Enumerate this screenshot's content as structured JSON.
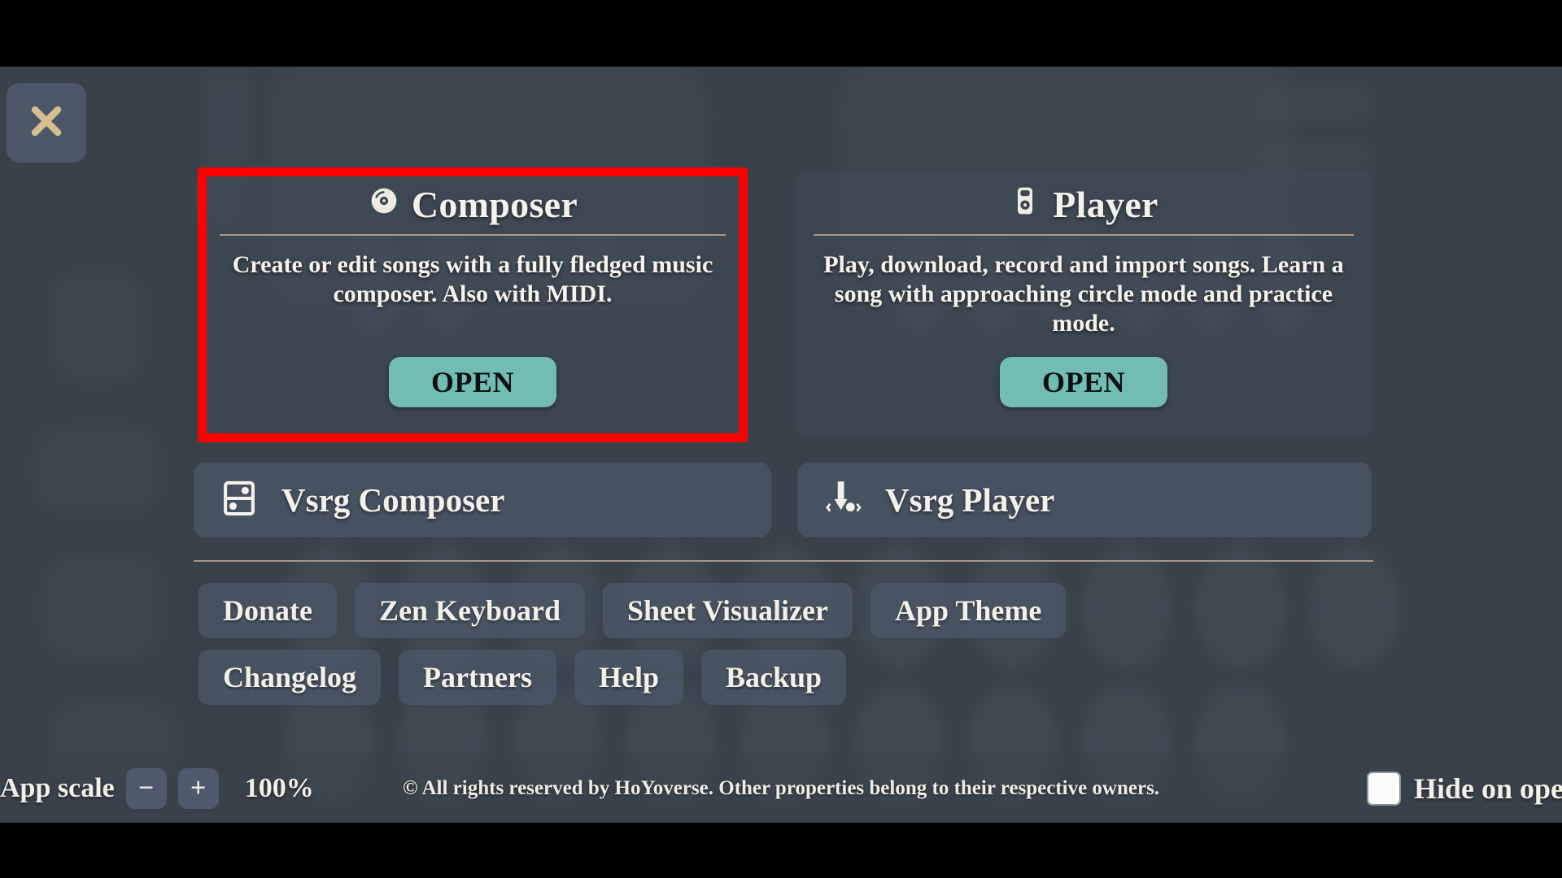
{
  "window": {
    "close_icon": "close-x-icon"
  },
  "cards": [
    {
      "id": "composer",
      "icon": "disc-icon",
      "title": "Composer",
      "description": "Create or edit songs with a fully fledged music composer. Also with MIDI.",
      "open_label": "OPEN",
      "highlighted": true
    },
    {
      "id": "player",
      "icon": "music-player-icon",
      "title": "Player",
      "description": "Play, download, record and import songs. Learn a song with approaching circle mode and practice mode.",
      "open_label": "OPEN",
      "highlighted": false
    }
  ],
  "vsrg": [
    {
      "id": "vsrg-composer",
      "icon": "vsrg-composer-icon",
      "label": "Vsrg Composer"
    },
    {
      "id": "vsrg-player",
      "icon": "vsrg-player-icon",
      "label": "Vsrg Player"
    }
  ],
  "pill_rows": [
    [
      {
        "id": "donate",
        "label": "Donate"
      },
      {
        "id": "zen-keyboard",
        "label": "Zen Keyboard"
      },
      {
        "id": "sheet-visualizer",
        "label": "Sheet Visualizer"
      },
      {
        "id": "app-theme",
        "label": "App Theme"
      }
    ],
    [
      {
        "id": "changelog",
        "label": "Changelog"
      },
      {
        "id": "partners",
        "label": "Partners"
      },
      {
        "id": "help",
        "label": "Help"
      },
      {
        "id": "backup",
        "label": "Backup"
      }
    ]
  ],
  "bottom_bar": {
    "scale_label": "App scale",
    "decrease_label": "−",
    "increase_label": "+",
    "scale_value": "100%",
    "copyright": "© All rights reserved by HoYoverse. Other properties belong to their respective owners.",
    "hide_on_open_label": "Hide on open",
    "hide_on_open_checked": false
  },
  "colors": {
    "app_background": "#3d464d",
    "card_background": "rgba(70,81,96,.30)",
    "open_button": "#72bdb3",
    "open_button_text": "#0d0f10",
    "divider": "#c8a88f",
    "highlight_outline": "#ff0000",
    "close_icon": "#d5bf91",
    "pill_background": "rgba(74,86,102,.86)",
    "text": "#f1f0e9"
  }
}
